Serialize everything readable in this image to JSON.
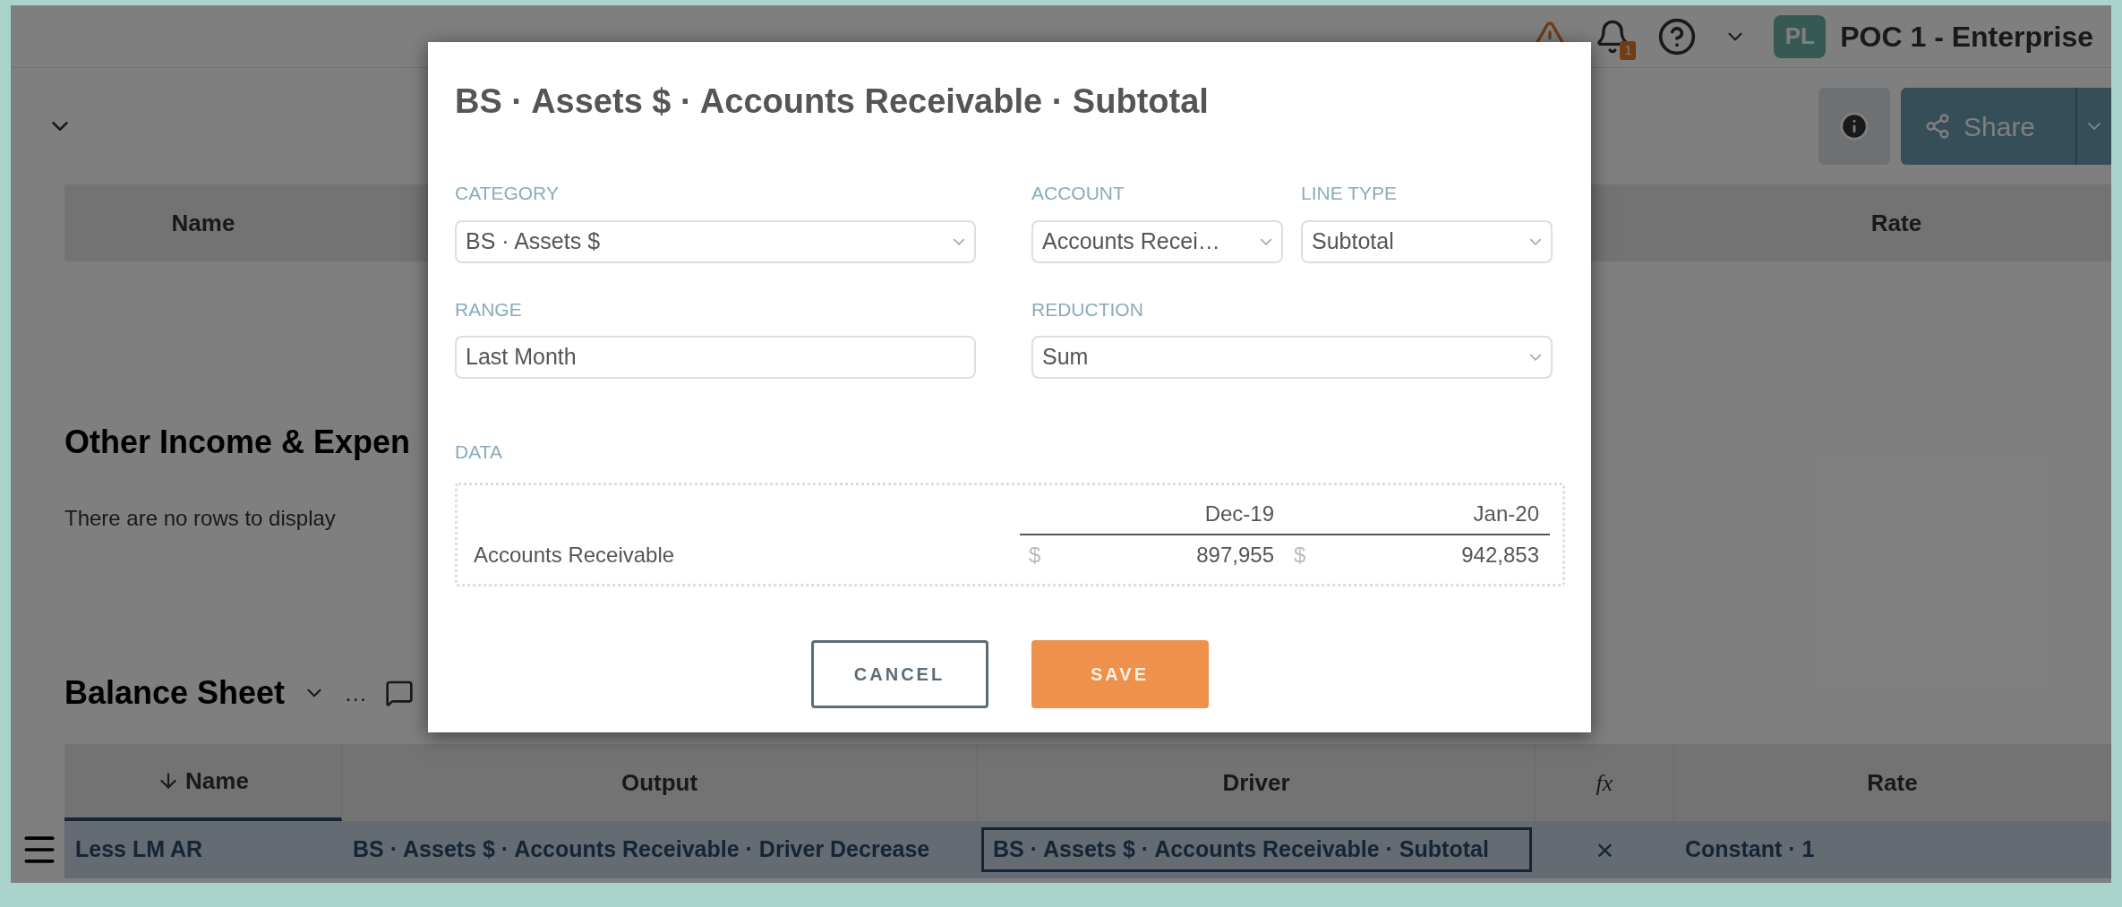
{
  "top_bar": {
    "badge": "1",
    "avatar": "PL",
    "workspace": "POC 1 - Enterprise"
  },
  "toolbar": {
    "share": "Share"
  },
  "top_table": {
    "columns": [
      "Name",
      "Rate"
    ]
  },
  "other_section": {
    "title": "Other Income & Expen",
    "empty_message": "There are no rows to display"
  },
  "balance_sheet": {
    "title": "Balance Sheet",
    "more": "…",
    "columns": [
      {
        "label": "Name",
        "sorted": true,
        "kind": "text"
      },
      {
        "label": "Output",
        "sorted": false,
        "kind": "text"
      },
      {
        "label": "Driver",
        "sorted": false,
        "kind": "text"
      },
      {
        "label": "fx",
        "sorted": false,
        "kind": "formula"
      },
      {
        "label": "Rate",
        "sorted": false,
        "kind": "text"
      }
    ],
    "rows": [
      {
        "name": "Less LM AR",
        "output": "BS · Assets $ · Accounts Receivable · Driver Decrease",
        "driver": "BS · Assets $ · Accounts Receivable · Subtotal",
        "driver_selected": true,
        "fx": "×",
        "rate": "Constant · 1"
      }
    ]
  },
  "dialog": {
    "title": "BS · Assets $ · Accounts Receivable · Subtotal",
    "field_rows": [
      [
        {
          "label": "CATEGORY",
          "value": "BS · Assets $",
          "kind": "select"
        },
        {
          "label": "ACCOUNT",
          "value": "Accounts Recei…",
          "kind": "select"
        },
        {
          "label": "LINE TYPE",
          "value": "Subtotal",
          "kind": "select"
        }
      ],
      [
        {
          "label": "RANGE",
          "value": "Last Month",
          "kind": "text"
        },
        {
          "label": "REDUCTION",
          "value": "Sum",
          "kind": "select"
        }
      ]
    ],
    "data": {
      "label": "DATA",
      "columns": [
        "Dec-19",
        "Jan-20"
      ],
      "rows": [
        {
          "name": "Accounts Receivable",
          "values": [
            {
              "currency": "$",
              "amount": "897,955"
            },
            {
              "currency": "$",
              "amount": "942,853"
            }
          ]
        }
      ]
    },
    "buttons": [
      {
        "label": "CANCEL",
        "kind": "secondary"
      },
      {
        "label": "SAVE",
        "kind": "primary"
      }
    ]
  }
}
